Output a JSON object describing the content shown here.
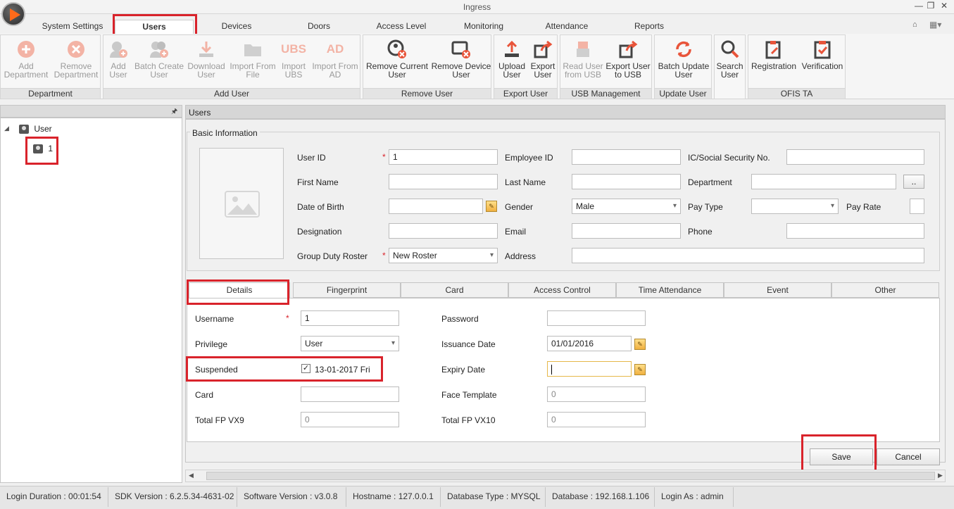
{
  "app": {
    "title": "Ingress"
  },
  "menu_tabs": [
    {
      "label": "System Settings"
    },
    {
      "label": "Users"
    },
    {
      "label": "Devices"
    },
    {
      "label": "Doors"
    },
    {
      "label": "Access Level"
    },
    {
      "label": "Monitoring"
    },
    {
      "label": "Attendance"
    },
    {
      "label": "Reports"
    }
  ],
  "ribbon": {
    "department": {
      "label": "Department",
      "add": "Add\nDepartment",
      "remove": "Remove\nDepartment"
    },
    "add_user": {
      "label": "Add User",
      "add": "Add\nUser",
      "batch": "Batch Create\nUser",
      "download": "Download\nUser",
      "import_file": "Import From\nFile",
      "import_ubs": "Import\nUBS",
      "import_ad": "Import From\nAD",
      "ubs_icon": "UBS",
      "ad_icon": "AD"
    },
    "remove_user": {
      "label": "Remove User",
      "current": "Remove Current\nUser",
      "device": "Remove Device\nUser"
    },
    "export_user": {
      "label": "Export User",
      "upload": "Upload\nUser",
      "export": "Export\nUser"
    },
    "usb": {
      "label": "USB Management",
      "read": "Read User\nfrom USB",
      "export": "Export User\nto USB"
    },
    "update_user": {
      "label": "Update User",
      "batch": "Batch Update\nUser"
    },
    "search": {
      "label": "Search\nUser"
    },
    "ofis": {
      "label": "OFIS TA",
      "registration": "Registration",
      "verification": "Verification"
    }
  },
  "tree": {
    "root": "User",
    "child": "1",
    "expander": "◢",
    "pin": "🖈"
  },
  "users_panel": {
    "title": "Users"
  },
  "basic_info": {
    "title": "Basic Information",
    "user_id_label": "User ID",
    "user_id_value": "1",
    "employee_id_label": "Employee ID",
    "ic_label": "IC/Social Security No.",
    "first_name_label": "First Name",
    "last_name_label": "Last Name",
    "department_label": "Department",
    "department_btn": "..",
    "dob_label": "Date of Birth",
    "gender_label": "Gender",
    "gender_value": "Male",
    "pay_type_label": "Pay Type",
    "pay_rate_label": "Pay Rate",
    "designation_label": "Designation",
    "email_label": "Email",
    "phone_label": "Phone",
    "roster_label": "Group Duty Roster",
    "roster_value": "New Roster",
    "address_label": "Address",
    "required_mark": "*"
  },
  "detail_tabs": [
    {
      "label": "Details"
    },
    {
      "label": "Fingerprint"
    },
    {
      "label": "Card"
    },
    {
      "label": "Access Control"
    },
    {
      "label": "Time Attendance"
    },
    {
      "label": "Event"
    },
    {
      "label": "Other"
    }
  ],
  "details": {
    "username_label": "Username",
    "username_value": "1",
    "password_label": "Password",
    "privilege_label": "Privilege",
    "privilege_value": "User",
    "issuance_label": "Issuance Date",
    "issuance_value": "01/01/2016",
    "suspended_label": "Suspended",
    "suspended_value": "13-01-2017 Fri",
    "suspended_check": "✓",
    "expiry_label": "Expiry Date",
    "card_label": "Card",
    "face_label": "Face Template",
    "face_value": "0",
    "fp9_label": "Total FP VX9",
    "fp9_value": "0",
    "fp10_label": "Total FP VX10",
    "fp10_value": "0"
  },
  "buttons": {
    "save": "Save",
    "cancel": "Cancel"
  },
  "status_bar": [
    {
      "text": "Login Duration : 00:01:54"
    },
    {
      "text": "SDK Version : 6.2.5.34-4631-02"
    },
    {
      "text": "Software Version : v3.0.8"
    },
    {
      "text": "Hostname : 127.0.0.1"
    },
    {
      "text": "Database Type : MYSQL"
    },
    {
      "text": "Database : 192.168.1.106"
    },
    {
      "text": "Login As : admin"
    }
  ],
  "colors": {
    "highlight": "#d9232b",
    "accent_orange": "#ff6a1a",
    "icon_red": "#e8543a"
  }
}
